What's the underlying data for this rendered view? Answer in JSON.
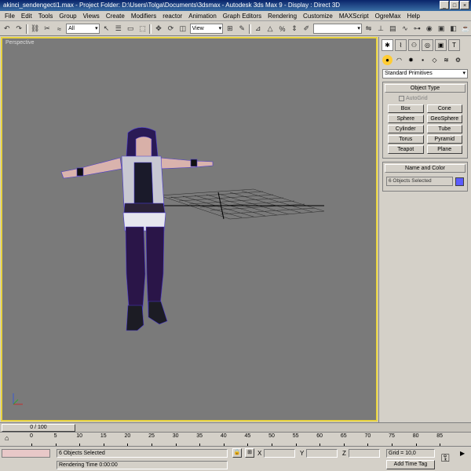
{
  "title": {
    "file": "akinci_sendengecti1.max",
    "project": "Project Folder: D:\\Users\\Tolga\\Documents\\3dsmax",
    "app": "Autodesk 3ds Max 9",
    "display": "Display : Direct 3D",
    "separator": "  -  "
  },
  "menu": [
    "File",
    "Edit",
    "Tools",
    "Group",
    "Views",
    "Create",
    "Modifiers",
    "reactor",
    "Animation",
    "Graph Editors",
    "Rendering",
    "Customize",
    "MAXScript",
    "OgreMax",
    "Help"
  ],
  "toolbar": {
    "selection_filter": "All",
    "ref_coord": "View"
  },
  "viewport": {
    "label": "Perspective"
  },
  "command_panel": {
    "category": "Standard Primitives",
    "object_type_header": "Object Type",
    "autogrid_label": "AutoGrid",
    "objects": [
      "Box",
      "Cone",
      "Sphere",
      "GeoSphere",
      "Cylinder",
      "Tube",
      "Torus",
      "Pyramid",
      "Teapot",
      "Plane"
    ],
    "name_color_header": "Name and Color",
    "name_value": "6 Objects Selected",
    "swatch_color": "#5c5cff"
  },
  "time": {
    "slider_label": "0 / 100",
    "ticks": [
      "0",
      "5",
      "10",
      "15",
      "20",
      "25",
      "30",
      "35",
      "40",
      "45",
      "50",
      "55",
      "60",
      "65",
      "70",
      "75",
      "80",
      "85"
    ]
  },
  "status": {
    "selection": "6 Objects Selected",
    "rendering": "Rendering Time  0:00:00",
    "x_label": "X",
    "y_label": "Y",
    "z_label": "Z",
    "grid": "Grid = 10,0",
    "add_time_tag": "Add Time Tag"
  }
}
